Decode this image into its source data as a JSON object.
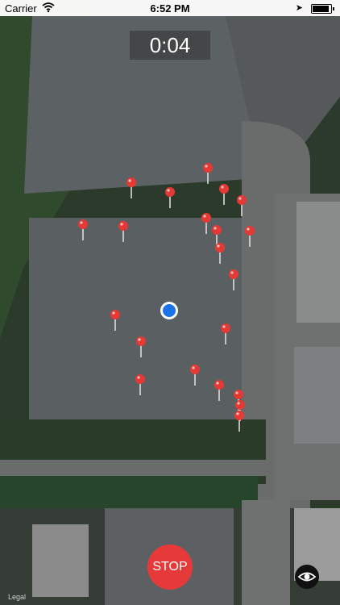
{
  "status_bar": {
    "carrier": "Carrier",
    "time": "6:52 PM"
  },
  "timer": {
    "value": "0:04"
  },
  "stop_button": {
    "label": "STOP"
  },
  "map": {
    "legal_label": "Legal",
    "pin_count": 21,
    "pin_color": "#e53935",
    "user_dot_color": "#1a73e8"
  },
  "icons": {
    "wifi": "wifi-icon",
    "location": "location-arrow-icon",
    "battery": "battery-icon",
    "eye": "eye-icon",
    "pin": "map-pin-icon"
  }
}
